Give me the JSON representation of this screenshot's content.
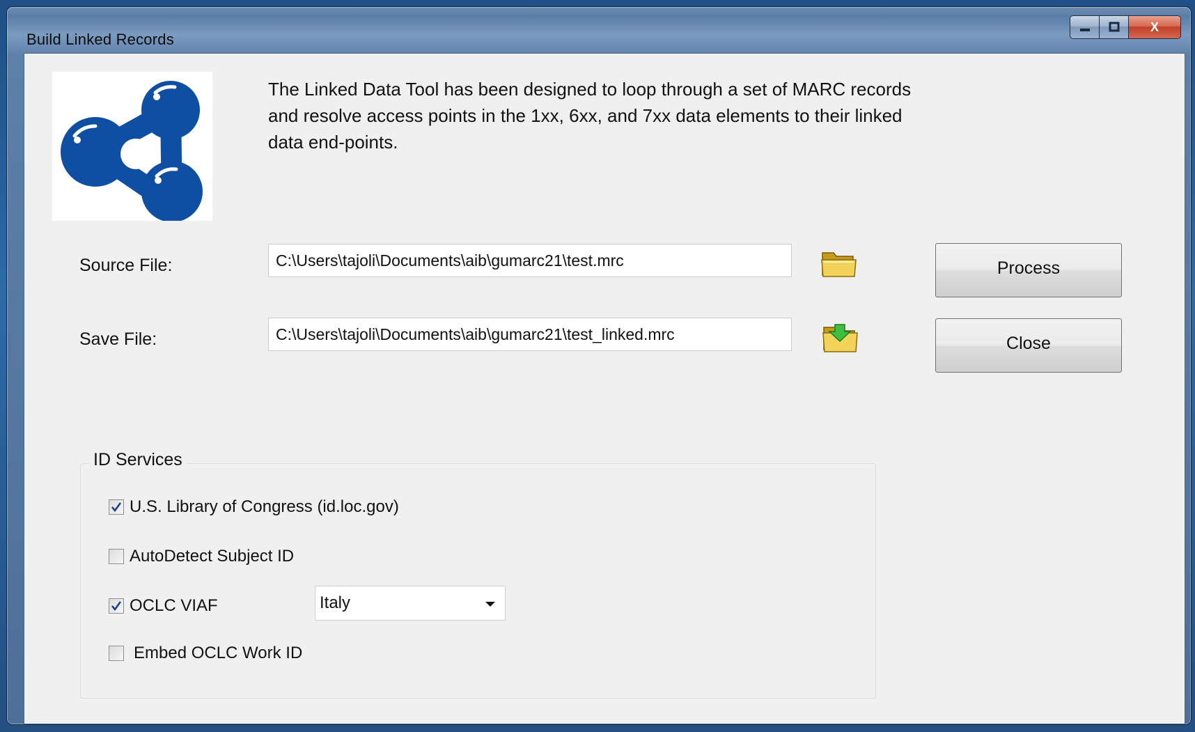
{
  "window": {
    "title": "Build Linked Records",
    "controls": {
      "minimize_icon": "minimize-icon",
      "maximize_icon": "maximize-icon",
      "close_label": "X"
    }
  },
  "logo": {
    "icon": "linked-data-logo-icon",
    "color": "#0f4fa3"
  },
  "description": "The Linked Data Tool has been designed to loop through a set of MARC records and resolve access points in the 1xx, 6xx, and 7xx data elements to their linked data end-points.",
  "source": {
    "label": "Source File:",
    "value": "C:\\Users\\tajoli\\Documents\\aib\\gumarc21\\test.mrc",
    "browse_icon": "folder-open-icon"
  },
  "save": {
    "label": "Save File:",
    "value": "C:\\Users\\tajoli\\Documents\\aib\\gumarc21\\test_linked.mrc",
    "browse_icon": "folder-save-icon"
  },
  "buttons": {
    "process": "Process",
    "close": "Close"
  },
  "id_services": {
    "title": "ID Services",
    "options": [
      {
        "label": "U.S. Library of Congress (id.loc.gov)",
        "checked": true
      },
      {
        "label": "AutoDetect Subject ID",
        "checked": false
      },
      {
        "label": "OCLC VIAF",
        "checked": true
      },
      {
        "label": "Embed OCLC Work ID",
        "checked": false
      }
    ],
    "viaf_country": "Italy"
  },
  "colors": {
    "accent": "#0f4fa3",
    "window_bg": "#f0f0f0",
    "check_mark": "#1d3f8a"
  }
}
